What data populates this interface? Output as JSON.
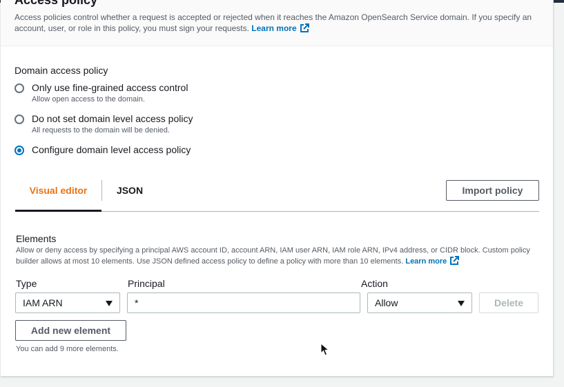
{
  "panel": {
    "title": "Access policy",
    "description": "Access policies control whether a request is accepted or rejected when it reaches the Amazon OpenSearch Service domain. If you specify an account, user, or role in this policy, you must sign your requests.",
    "learn_more": "Learn more"
  },
  "domain_policy": {
    "label": "Domain access policy",
    "options": [
      {
        "label": "Only use fine-grained access control",
        "description": "Allow open access to the domain.",
        "selected": false
      },
      {
        "label": "Do not set domain level access policy",
        "description": "All requests to the domain will be denied.",
        "selected": false
      },
      {
        "label": "Configure domain level access policy",
        "description": "",
        "selected": true
      }
    ]
  },
  "tabs": [
    {
      "label": "Visual editor",
      "active": true
    },
    {
      "label": "JSON",
      "active": false
    }
  ],
  "import_button": "Import policy",
  "elements": {
    "title": "Elements",
    "description": "Allow or deny access by specifying a principal AWS account ID, account ARN, IAM user ARN, IAM role ARN, IPv4 address, or CIDR block. Custom policy builder allows at most 10 elements. Use JSON defined access policy to define a policy with more than 10 elements.",
    "learn_more": "Learn more",
    "columns": {
      "type": "Type",
      "principal": "Principal",
      "action": "Action"
    },
    "row": {
      "type": "IAM ARN",
      "principal": "*",
      "action": "Allow",
      "delete": "Delete"
    },
    "add_button": "Add new element",
    "hint": "You can add 9 more elements."
  },
  "colors": {
    "link": "#0073bb",
    "active_tab": "#ec7211",
    "radio_selected": "#0073bb"
  },
  "icons": [
    "external-link-icon",
    "caret-down-icon",
    "mouse-pointer-icon"
  ]
}
